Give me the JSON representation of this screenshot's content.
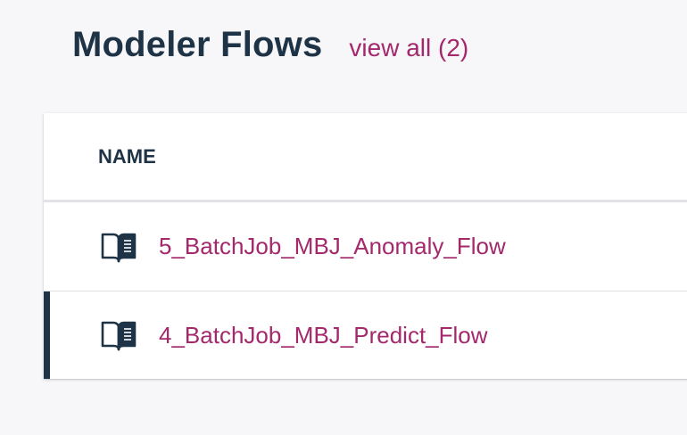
{
  "header": {
    "title": "Modeler Flows",
    "view_all_label": "view all (2)"
  },
  "table": {
    "columns": [
      "NAME"
    ],
    "rows": [
      {
        "name": "5_BatchJob_MBJ_Anomaly_Flow",
        "icon": "modeler-flow-icon",
        "selected": false
      },
      {
        "name": "4_BatchJob_MBJ_Predict_Flow",
        "icon": "modeler-flow-icon",
        "selected": true
      }
    ]
  },
  "colors": {
    "title": "#1f3346",
    "link": "#a3286c",
    "selection_bar": "#1f3346",
    "background": "#f7f7f9"
  }
}
